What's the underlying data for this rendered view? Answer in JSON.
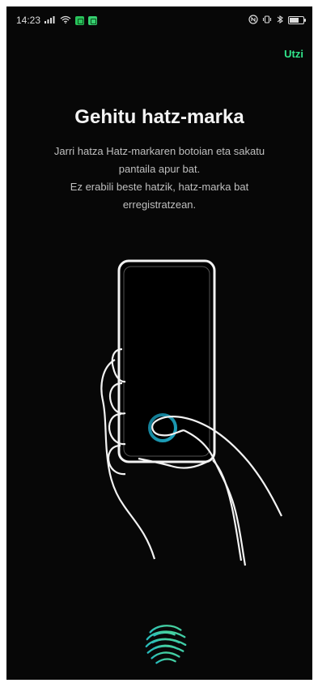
{
  "status_bar": {
    "time": "14:23",
    "icons_left": [
      "signal-icon",
      "wifi-icon",
      "app-notification-icon",
      "call-notification-icon"
    ],
    "icons_right": [
      "nfc-icon",
      "vibrate-icon",
      "bluetooth-icon",
      "battery-icon"
    ]
  },
  "header": {
    "skip_label": "Utzi"
  },
  "main": {
    "title": "Gehitu hatz-marka",
    "description_lines": [
      "Jarri hatza Hatz-markaren botoian eta sakatu",
      "pantaila apur bat.",
      "Ez erabili beste hatzik, hatz-marka bat",
      "erregistratzean."
    ]
  },
  "colors": {
    "background": "#070707",
    "accent": "#31e58b",
    "ring": "#1fa7c1",
    "fingerprint_gradient": [
      "#26b9bd",
      "#4dd69a"
    ]
  }
}
